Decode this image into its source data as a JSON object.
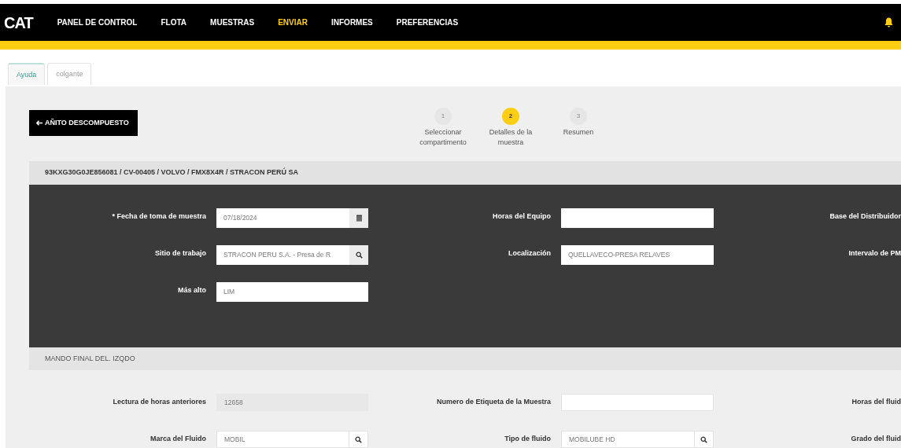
{
  "navbar": {
    "logo": "CAT",
    "items": [
      {
        "label": "PANEL DE CONTROL",
        "selected": false
      },
      {
        "label": "FLOTA",
        "selected": false
      },
      {
        "label": "MUESTRAS",
        "selected": false
      },
      {
        "label": "ENVIAR",
        "selected": true
      },
      {
        "label": "INFORMES",
        "selected": false
      },
      {
        "label": "PREFERENCIAS",
        "selected": false
      }
    ]
  },
  "tabs": [
    {
      "label": "Ayuda",
      "selected": true
    },
    {
      "label": "colgante",
      "selected": false
    }
  ],
  "back_button": {
    "label": "AÑITO DESCOMPUESTO"
  },
  "steps": [
    {
      "number": "1",
      "label": "Seleccionar compartimento",
      "selected": false
    },
    {
      "number": "2",
      "label": "Detalles de la muestra",
      "selected": true
    },
    {
      "number": "3",
      "label": "Resumen",
      "selected": false
    }
  ],
  "equipment_header": "93KXG30G0JE856081 / CV-00405 / VOLVO / FMX8X4R / STRACON PERÚ SA",
  "sample_panel": {
    "rows": [
      [
        {
          "kind": "input",
          "label": "* Fecha de toma de muestra",
          "value": "07/18/2024",
          "addon": {
            "kind": "calendar"
          }
        },
        {
          "kind": "input",
          "label": "Horas del Equipo"
        },
        {
          "kind": "label",
          "label": "Base del Distribuidor"
        }
      ],
      [
        {
          "kind": "input",
          "label": "Sitio de trabajo",
          "value": "STRACON PERU S.A. - Presa de R",
          "addon": {
            "kind": "search"
          }
        },
        {
          "kind": "input",
          "label": "Localización",
          "value": "QUELLAVECO-PRESA RELAVES"
        },
        {
          "kind": "label",
          "label": "Intervalo de PM"
        }
      ],
      [
        {
          "kind": "input",
          "label": "Más alto",
          "value": "LIM"
        }
      ]
    ]
  },
  "compartment": {
    "title": "MANDO FINAL DEL. IZQDO",
    "rows": [
      [
        {
          "kind": "input",
          "label": "Lectura de horas anteriores",
          "value": "12658",
          "disabled": true
        },
        {
          "kind": "input",
          "label": "Numero de Etiqueta de la Muestra"
        },
        {
          "kind": "label",
          "label": "Horas del fluid"
        }
      ],
      [
        {
          "kind": "input",
          "label": "Marca del Fluido",
          "value": "MOBIL",
          "addon": {
            "kind": "search"
          }
        },
        {
          "kind": "input",
          "label": "Tipo de fluido",
          "value": "MOBILUBE HD",
          "addon": {
            "kind": "search"
          }
        },
        {
          "kind": "label",
          "label": "Grado del fluid"
        }
      ]
    ]
  }
}
